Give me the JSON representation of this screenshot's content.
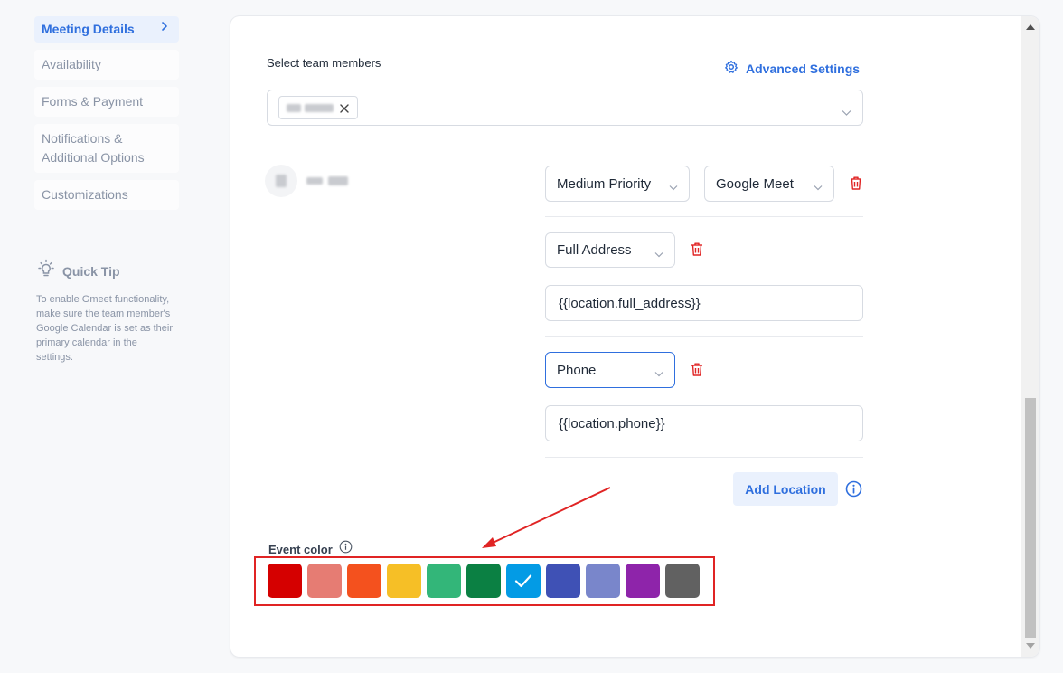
{
  "sidebar": {
    "items": [
      {
        "label": "Meeting Details",
        "active": true
      },
      {
        "label": "Availability",
        "active": false
      },
      {
        "label": "Forms & Payment",
        "active": false
      },
      {
        "label": "Notifications & Additional Options",
        "active": false
      },
      {
        "label": "Customizations",
        "active": false
      }
    ],
    "tip": {
      "title": "Quick Tip",
      "body": "To enable Gmeet functionality, make sure the team member's Google Calendar is set as their primary calendar in the settings."
    }
  },
  "team": {
    "label": "Select team members",
    "advanced_settings": "Advanced Settings",
    "member": {
      "priority": "Medium Priority",
      "location": "Google Meet"
    }
  },
  "locations": [
    {
      "type": "Full Address",
      "value": "{{location.full_address}}"
    },
    {
      "type": "Phone",
      "value": "{{location.phone}}"
    }
  ],
  "add_location": "Add Location",
  "event_color": {
    "label": "Event color",
    "selected_index": 6,
    "swatches": [
      "#d50000",
      "#e67c73",
      "#f4511e",
      "#f6bf26",
      "#33b679",
      "#0b8043",
      "#039be5",
      "#3f51b5",
      "#7986cb",
      "#8e24aa",
      "#616161"
    ]
  },
  "colors": {
    "accent": "#2f6fde",
    "danger": "#e02424",
    "annotation": "#e02424"
  }
}
